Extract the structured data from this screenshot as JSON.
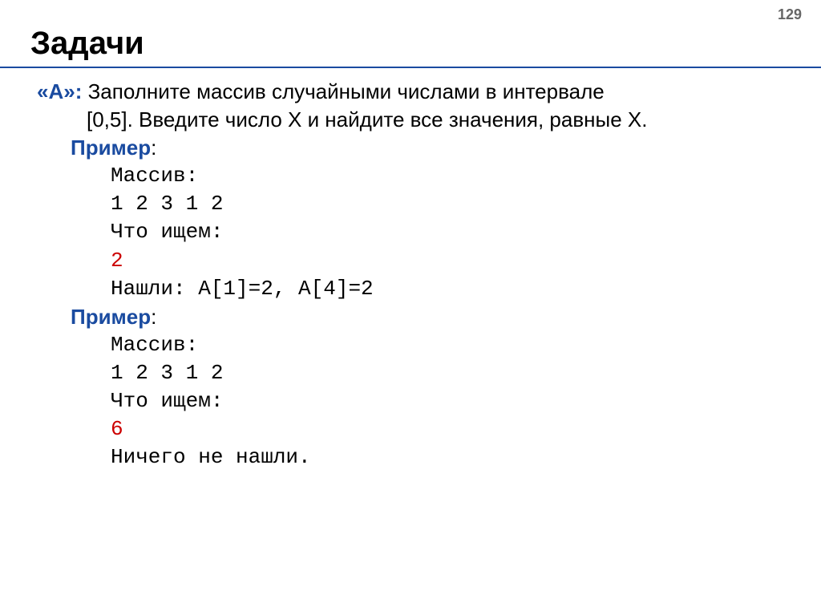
{
  "page_number": "129",
  "title": "Задачи",
  "task": {
    "label": "«A»:",
    "text_line1": " Заполните массив случайными числами в интервале",
    "text_line2": "[0,5]. Введите число X и найдите все значения, равные X."
  },
  "example1": {
    "label": "Пример",
    "colon": ":",
    "lines": {
      "l1": "Массив:",
      "l2": "1 2 3 1 2",
      "l3": "Что ищем:",
      "l4": "2",
      "l5": "Нашли: A[1]=2, A[4]=2"
    }
  },
  "example2": {
    "label": "Пример",
    "colon": ":",
    "lines": {
      "l1": "Массив:",
      "l2": "1 2 3 1 2",
      "l3": "Что ищем:",
      "l4": "6",
      "l5": "Ничего не нашли."
    }
  }
}
